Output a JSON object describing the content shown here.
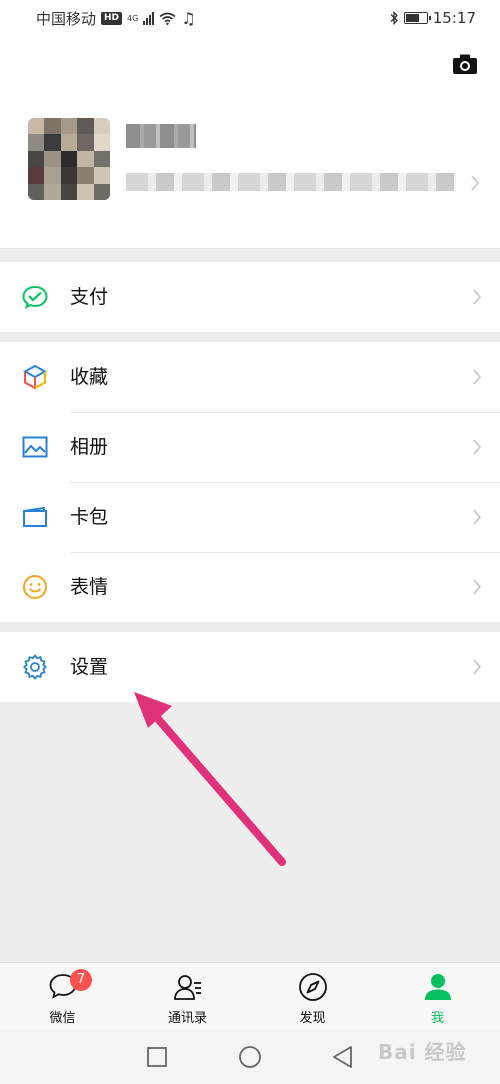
{
  "status_bar": {
    "carrier": "中国移动",
    "hd": "HD",
    "network": "4G",
    "time": "15:17",
    "battery_level": 0.7
  },
  "menu": {
    "pay": {
      "label": "支付",
      "icon": "wechat-pay-icon",
      "color": "#07c160"
    },
    "favorites": {
      "label": "收藏",
      "icon": "cube-icon"
    },
    "album": {
      "label": "相册",
      "icon": "image-icon",
      "color": "#2782d7"
    },
    "cards": {
      "label": "卡包",
      "icon": "card-wallet-icon",
      "color": "#2782d7"
    },
    "stickers": {
      "label": "表情",
      "icon": "smiley-icon",
      "color": "#f5a623"
    },
    "settings": {
      "label": "设置",
      "icon": "gear-icon",
      "color": "#2782d7"
    }
  },
  "tab_bar": {
    "chats": {
      "label": "微信",
      "badge": "7"
    },
    "contacts": {
      "label": "通讯录"
    },
    "discover": {
      "label": "发现"
    },
    "me": {
      "label": "我",
      "active": true
    }
  },
  "colors": {
    "brand_green": "#07c160",
    "annotation_arrow": "#e0327a",
    "badge_red": "#fa5151"
  },
  "watermark": "Bai 经验"
}
